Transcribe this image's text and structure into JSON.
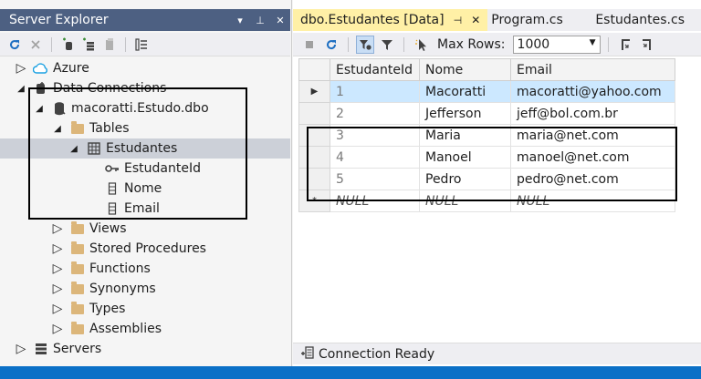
{
  "server_explorer": {
    "title": "Server Explorer",
    "pin_glyph": "▾",
    "autohide_glyph": "⊥",
    "close_glyph": "✕",
    "tree": [
      {
        "label": "Azure",
        "expander": "▷"
      },
      {
        "label": "Data Connections",
        "expander": "◢"
      },
      {
        "label": "macoratti.Estudo.dbo",
        "expander": "◢"
      },
      {
        "label": "Tables",
        "expander": "◢"
      },
      {
        "label": "Estudantes",
        "expander": "◢"
      },
      {
        "label": "EstudanteId",
        "expander": ""
      },
      {
        "label": "Nome",
        "expander": ""
      },
      {
        "label": "Email",
        "expander": ""
      },
      {
        "label": "Views",
        "expander": "▷"
      },
      {
        "label": "Stored Procedures",
        "expander": "▷"
      },
      {
        "label": "Functions",
        "expander": "▷"
      },
      {
        "label": "Synonyms",
        "expander": "▷"
      },
      {
        "label": "Types",
        "expander": "▷"
      },
      {
        "label": "Assemblies",
        "expander": "▷"
      },
      {
        "label": "Servers",
        "expander": "▷"
      }
    ]
  },
  "tabs": [
    {
      "label": "dbo.Estudantes [Data]",
      "pin": "⊣",
      "close": "✕"
    },
    {
      "label": "Program.cs"
    },
    {
      "label": "Estudantes.cs"
    }
  ],
  "doc_toolbar": {
    "max_rows_label": "Max Rows:",
    "max_rows_value": "1000"
  },
  "grid": {
    "columns": [
      "EstudanteId",
      "Nome",
      "Email"
    ],
    "rows": [
      {
        "marker": "▶",
        "id": "1",
        "nome": "Macoratti",
        "email": "macoratti@yahoo.com"
      },
      {
        "marker": "",
        "id": "2",
        "nome": "Jefferson",
        "email": "jeff@bol.com.br"
      },
      {
        "marker": "",
        "id": "3",
        "nome": "Maria",
        "email": "maria@net.com"
      },
      {
        "marker": "",
        "id": "4",
        "nome": "Manoel",
        "email": "manoel@net.com"
      },
      {
        "marker": "",
        "id": "5",
        "nome": "Pedro",
        "email": "pedro@net.com"
      },
      {
        "marker": "*",
        "id": "NULL",
        "nome": "NULL",
        "email": "NULL"
      }
    ]
  },
  "status": {
    "text": "Connection Ready"
  },
  "colors": {
    "title_bar": "#4d6082",
    "active_tab": "#fff0a6",
    "selected_row": "#cce8ff",
    "bottom_bar": "#0b70c7"
  }
}
